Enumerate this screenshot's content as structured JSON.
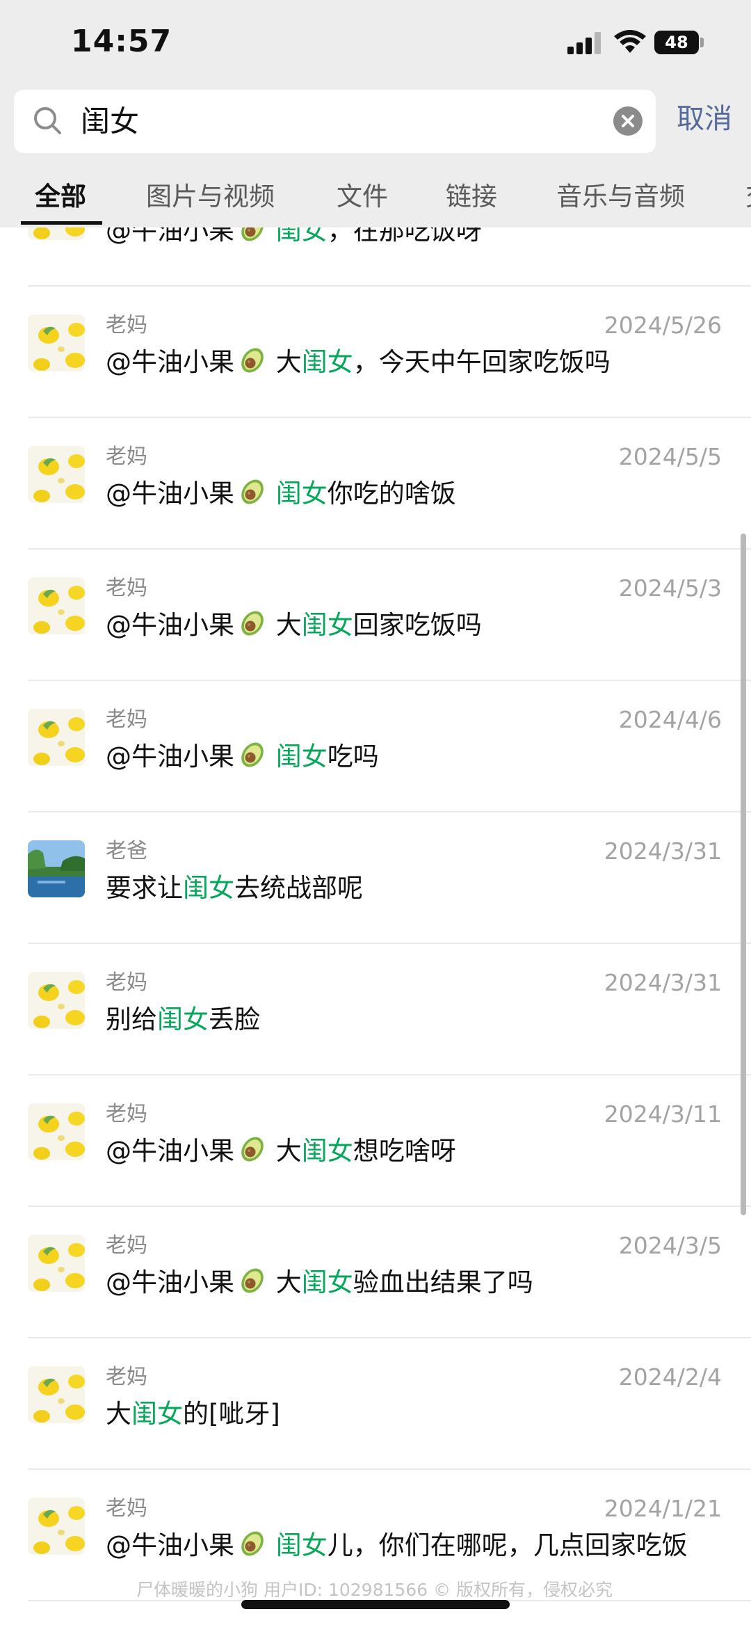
{
  "status": {
    "time": "14:57",
    "battery": "48"
  },
  "search": {
    "query": "闺女",
    "cancel_label": "取消"
  },
  "tabs": [
    "全部",
    "图片与视频",
    "文件",
    "链接",
    "音乐与音频",
    "交"
  ],
  "colors": {
    "highlight": "#07a75b",
    "cancel": "#56699b"
  },
  "results": [
    {
      "sender": "",
      "date": "",
      "avatar": "lemon-avatar",
      "parts": [
        [
          "@牛油小果",
          0
        ],
        [
          "AVO",
          0
        ],
        [
          " ",
          0
        ],
        [
          "闺女",
          1
        ],
        [
          "，在那吃饭呀",
          0
        ]
      ]
    },
    {
      "sender": "老妈",
      "date": "2024/5/26",
      "avatar": "lemon-avatar",
      "parts": [
        [
          "@牛油小果",
          0
        ],
        [
          "AVO",
          0
        ],
        [
          " 大",
          0
        ],
        [
          "闺女",
          1
        ],
        [
          "，今天中午回家吃饭吗",
          0
        ]
      ]
    },
    {
      "sender": "老妈",
      "date": "2024/5/5",
      "avatar": "lemon-avatar",
      "parts": [
        [
          "@牛油小果",
          0
        ],
        [
          "AVO",
          0
        ],
        [
          " ",
          0
        ],
        [
          "闺女",
          1
        ],
        [
          "你吃的啥饭",
          0
        ]
      ]
    },
    {
      "sender": "老妈",
      "date": "2024/5/3",
      "avatar": "lemon-avatar",
      "parts": [
        [
          "@牛油小果",
          0
        ],
        [
          "AVO",
          0
        ],
        [
          "  大",
          0
        ],
        [
          "闺女",
          1
        ],
        [
          "回家吃饭吗",
          0
        ]
      ]
    },
    {
      "sender": "老妈",
      "date": "2024/4/6",
      "avatar": "lemon-avatar",
      "parts": [
        [
          "@牛油小果",
          0
        ],
        [
          "AVO",
          0
        ],
        [
          " ",
          0
        ],
        [
          "闺女",
          1
        ],
        [
          "吃吗",
          0
        ]
      ]
    },
    {
      "sender": "老爸",
      "date": "2024/3/31",
      "avatar": "landscape-avatar",
      "parts": [
        [
          "要求让",
          0
        ],
        [
          "闺女",
          1
        ],
        [
          "去统战部呢",
          0
        ]
      ]
    },
    {
      "sender": "老妈",
      "date": "2024/3/31",
      "avatar": "lemon-avatar",
      "parts": [
        [
          "别给",
          0
        ],
        [
          "闺女",
          1
        ],
        [
          "丢脸",
          0
        ]
      ]
    },
    {
      "sender": "老妈",
      "date": "2024/3/11",
      "avatar": "lemon-avatar",
      "parts": [
        [
          "@牛油小果",
          0
        ],
        [
          "AVO",
          0
        ],
        [
          " 大",
          0
        ],
        [
          "闺女",
          1
        ],
        [
          "想吃啥呀",
          0
        ]
      ]
    },
    {
      "sender": "老妈",
      "date": "2024/3/5",
      "avatar": "lemon-avatar",
      "parts": [
        [
          "@牛油小果",
          0
        ],
        [
          "AVO",
          0
        ],
        [
          "  大",
          0
        ],
        [
          "闺女",
          1
        ],
        [
          "验血出结果了吗",
          0
        ]
      ]
    },
    {
      "sender": "老妈",
      "date": "2024/2/4",
      "avatar": "lemon-avatar",
      "parts": [
        [
          "大",
          0
        ],
        [
          "闺女",
          1
        ],
        [
          "的[呲牙]",
          0
        ]
      ]
    },
    {
      "sender": "老妈",
      "date": "2024/1/21",
      "avatar": "lemon-avatar",
      "parts": [
        [
          "@牛油小果",
          0
        ],
        [
          "AVO",
          0
        ],
        [
          " ",
          0
        ],
        [
          "闺女",
          1
        ],
        [
          "儿，你们在哪呢，几点回家吃饭",
          0
        ]
      ]
    }
  ],
  "watermark": "尸体暖暖的小狗   用户ID: 102981566   © 版权所有，侵权必究"
}
